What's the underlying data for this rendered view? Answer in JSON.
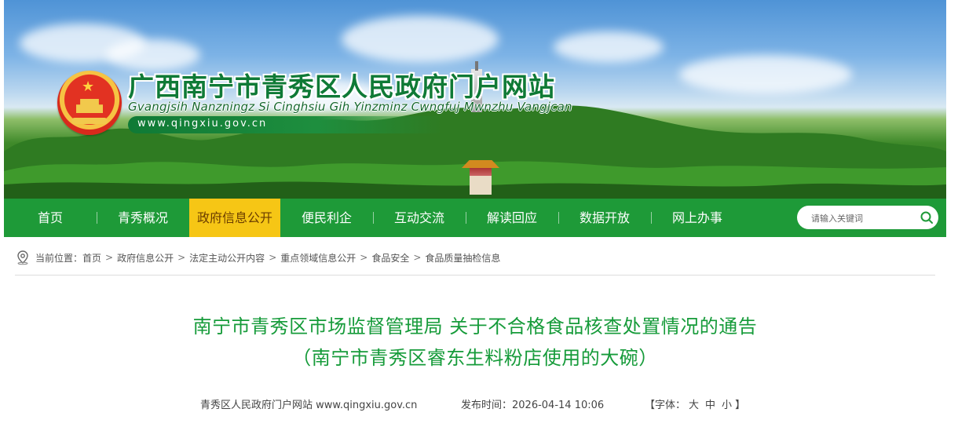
{
  "header": {
    "site_title": "广西南宁市青秀区人民政府门户网站",
    "site_subtitle": "Gvangjsih Nanzningz Si Cinghsiu Gih Yinzminz Cwngfuj Mwnzhu Vangjcan",
    "site_domain": "www.qingxiu.gov.cn"
  },
  "nav": {
    "items": [
      {
        "label": "首页"
      },
      {
        "label": "青秀概况"
      },
      {
        "label": "政府信息公开",
        "active": true
      },
      {
        "label": "便民利企"
      },
      {
        "label": "互动交流"
      },
      {
        "label": "解读回应"
      },
      {
        "label": "数据开放"
      },
      {
        "label": "网上办事"
      }
    ],
    "search_placeholder": "请输入关键词",
    "active_color": "#f6c615",
    "bar_color": "#1e9a38"
  },
  "breadcrumb": {
    "prefix": "当前位置：",
    "items": [
      "首页",
      "政府信息公开",
      "法定主动公开内容",
      "重点领域信息公开",
      "食品安全",
      "食品质量抽检信息"
    ],
    "separator": ">"
  },
  "article": {
    "title_line1": "南宁市青秀区市场监督管理局 关于不合格食品核查处置情况的通告",
    "title_line2": "（南宁市青秀区睿东生料粉店使用的大碗）",
    "source": "青秀区人民政府门户网站 www.qingxiu.gov.cn",
    "publish_label": "发布时间：",
    "publish_time": "2026-04-14 10:06",
    "font_size": {
      "open": "【字体：",
      "large": "大",
      "medium": "中",
      "small": "小",
      "close": "】"
    },
    "title_color": "#169b3a"
  }
}
